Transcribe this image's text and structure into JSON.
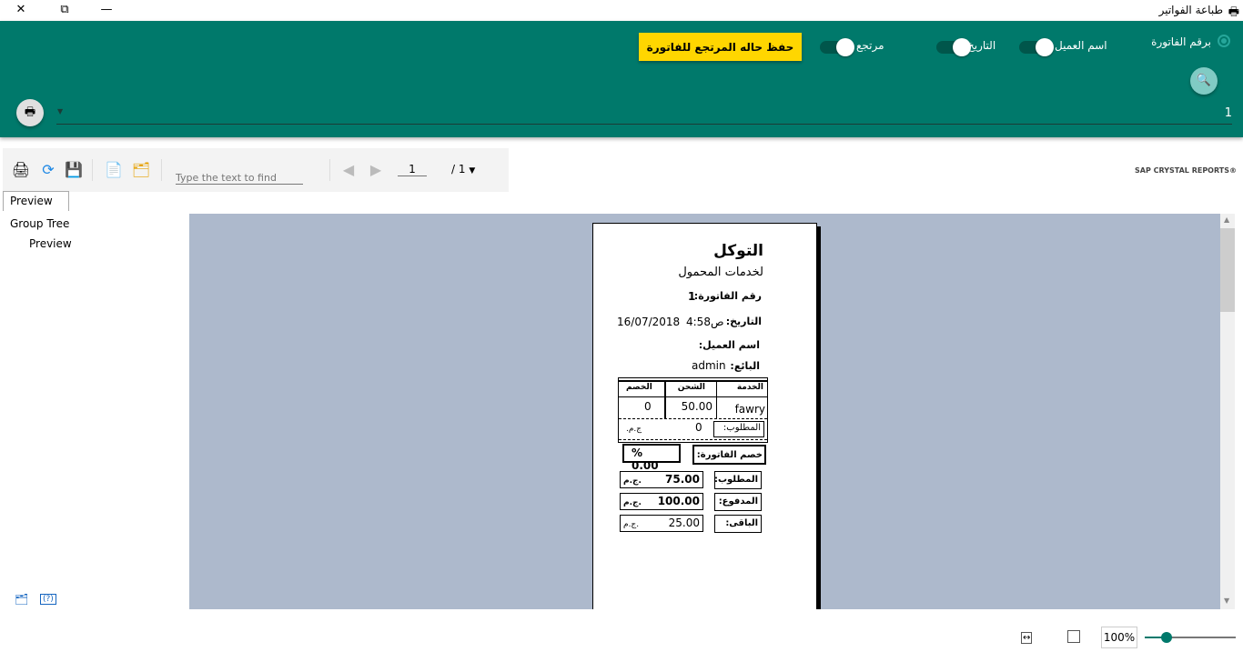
{
  "window": {
    "title": "طباعة الفواتير",
    "close": "✕",
    "restore": "⧉",
    "minimize": "—",
    "icon": "printer-icon"
  },
  "header": {
    "radio_label": "برقم الفاتورة",
    "toggles": [
      {
        "label": "اسم العميل",
        "on": true
      },
      {
        "label": "التاريخ",
        "on": true
      },
      {
        "label": "مرتجع",
        "on": true
      }
    ],
    "save_button": "حفظ حاله المرتجع للفاتورة",
    "search_value": "1",
    "accent": "#00796b",
    "button_color": "#ffd600"
  },
  "toolbar": {
    "find_placeholder": "Type the text to find",
    "page": "1",
    "page_total": "/ 1",
    "brand": "SAP CRYSTAL REPORTS®"
  },
  "tabs": {
    "preview": "Preview"
  },
  "tree": {
    "root": "Group Tree",
    "child": "Preview"
  },
  "report": {
    "shop": "التوكل",
    "subtitle": "لخدمات المحمول",
    "invoice_label": "رقم الفاتورة:",
    "invoice_no": "1",
    "date_label": "التاريخ:",
    "time": "ص4:58",
    "date": "16/07/2018",
    "customer_label": "اسم العميل:",
    "seller_label": "البائع:",
    "seller": "admin",
    "columns": [
      "الخدمة",
      "الشحن",
      "الخصم"
    ],
    "row": [
      "fawry",
      "50.00",
      "0"
    ],
    "sub_label": "المطلوب:",
    "sub_value": "0",
    "currency": "ج.م.",
    "discount_label": "خصم الفاتورة:",
    "discount_value": "0.00",
    "percent": "%",
    "required_label": "المطلوب:",
    "required": "75.00",
    "paid_label": "المدفوع:",
    "paid": "100.00",
    "remain_label": "الباقى:",
    "remain": "25.00"
  },
  "zoom": {
    "value": "100%",
    "level": 100
  }
}
